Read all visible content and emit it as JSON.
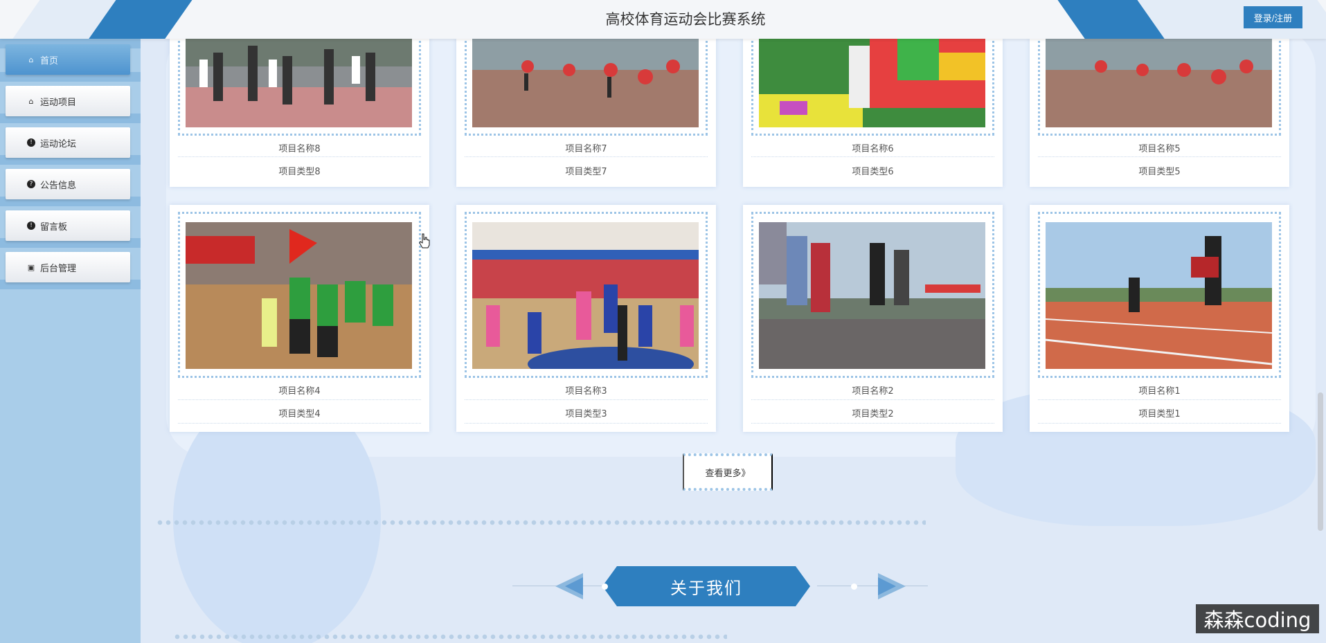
{
  "header": {
    "title": "高校体育运动会比赛系统",
    "login_label": "登录/注册"
  },
  "sidebar": {
    "items": [
      {
        "label": "首页",
        "icon": "home-icon",
        "active": true
      },
      {
        "label": "运动项目",
        "icon": "bag-icon",
        "active": false
      },
      {
        "label": "运动论坛",
        "icon": "info-icon",
        "active": false
      },
      {
        "label": "公告信息",
        "icon": "question-icon",
        "active": false
      },
      {
        "label": "留言板",
        "icon": "info-icon",
        "active": false
      },
      {
        "label": "后台管理",
        "icon": "briefcase-icon",
        "active": false
      }
    ]
  },
  "projects": [
    {
      "name": "项目名称8",
      "type": "项目类型8"
    },
    {
      "name": "项目名称7",
      "type": "项目类型7"
    },
    {
      "name": "项目名称6",
      "type": "项目类型6"
    },
    {
      "name": "项目名称5",
      "type": "项目类型5"
    },
    {
      "name": "项目名称4",
      "type": "项目类型4"
    },
    {
      "name": "项目名称3",
      "type": "项目类型3"
    },
    {
      "name": "项目名称2",
      "type": "项目类型2"
    },
    {
      "name": "项目名称1",
      "type": "项目类型1"
    }
  ],
  "more_label": "查看更多》",
  "about": {
    "title": "关于我们"
  },
  "watermark": "森森coding",
  "colors": {
    "accent": "#2e7fbf",
    "sidebar": "#a9cde9",
    "background": "#dfe9f7"
  }
}
